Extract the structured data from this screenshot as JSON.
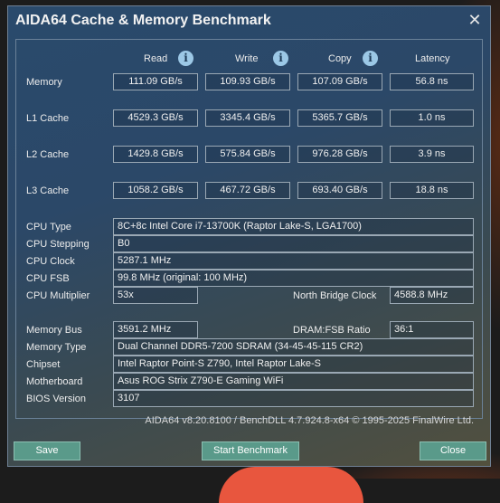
{
  "window": {
    "title": "AIDA64 Cache & Memory Benchmark",
    "close_glyph": "✕"
  },
  "columns": {
    "read": "Read",
    "write": "Write",
    "copy": "Copy",
    "latency": "Latency"
  },
  "info_icon_glyph": "i",
  "rows": [
    {
      "label": "Memory",
      "read": "111.09 GB/s",
      "write": "109.93 GB/s",
      "copy": "107.09 GB/s",
      "latency": "56.8 ns"
    },
    {
      "label": "L1 Cache",
      "read": "4529.3 GB/s",
      "write": "3345.4 GB/s",
      "copy": "5365.7 GB/s",
      "latency": "1.0 ns"
    },
    {
      "label": "L2 Cache",
      "read": "1429.8 GB/s",
      "write": "575.84 GB/s",
      "copy": "976.28 GB/s",
      "latency": "3.9 ns"
    },
    {
      "label": "L3 Cache",
      "read": "1058.2 GB/s",
      "write": "467.72 GB/s",
      "copy": "693.40 GB/s",
      "latency": "18.8 ns"
    }
  ],
  "cpu": {
    "type_label": "CPU Type",
    "type_value": "8C+8c Intel Core i7-13700K  (Raptor Lake-S, LGA1700)",
    "stepping_label": "CPU Stepping",
    "stepping_value": "B0",
    "clock_label": "CPU Clock",
    "clock_value": "5287.1 MHz",
    "fsb_label": "CPU FSB",
    "fsb_value": "99.8 MHz  (original: 100 MHz)",
    "multiplier_label": "CPU Multiplier",
    "multiplier_value": "53x",
    "nb_clock_label": "North Bridge Clock",
    "nb_clock_value": "4588.8 MHz"
  },
  "memory": {
    "bus_label": "Memory Bus",
    "bus_value": "3591.2 MHz",
    "ratio_label": "DRAM:FSB Ratio",
    "ratio_value": "36:1",
    "type_label": "Memory Type",
    "type_value": "Dual Channel DDR5-7200 SDRAM  (34-45-45-115 CR2)",
    "chipset_label": "Chipset",
    "chipset_value": "Intel Raptor Point-S Z790, Intel Raptor Lake-S",
    "mobo_label": "Motherboard",
    "mobo_value": "Asus ROG Strix Z790-E Gaming WiFi",
    "bios_label": "BIOS Version",
    "bios_value": "3107"
  },
  "footer": "AIDA64 v8.20.8100 / BenchDLL 4.7.924.8-x64  © 1995-2025 FinalWire Ltd.",
  "buttons": {
    "save": "Save",
    "start": "Start Benchmark",
    "close": "Close"
  }
}
